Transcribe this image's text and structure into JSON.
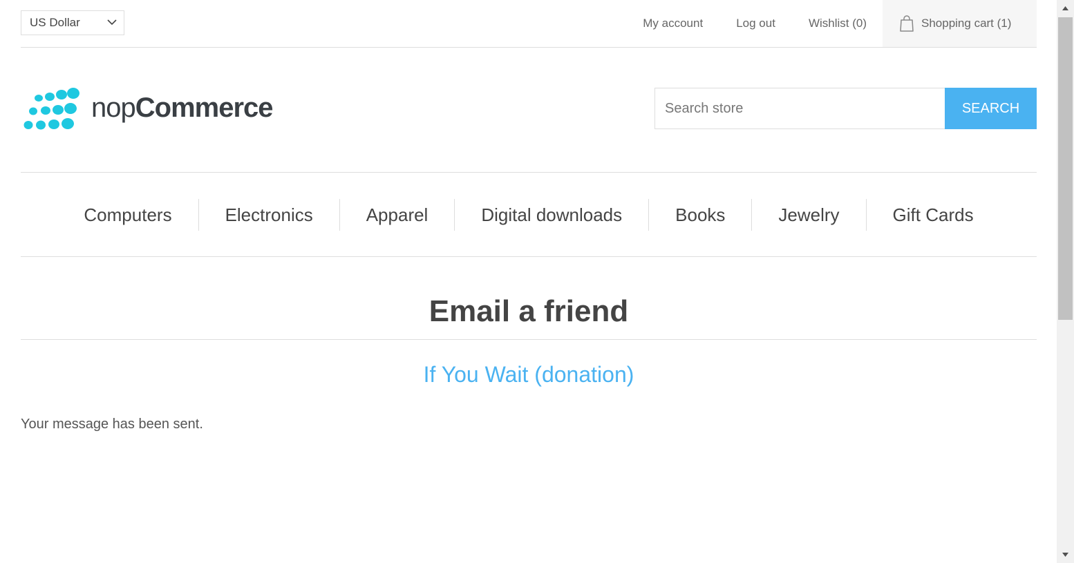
{
  "header": {
    "currency": "US Dollar",
    "links": {
      "my_account": "My account",
      "log_out": "Log out",
      "wishlist": "Wishlist (0)",
      "shopping_cart": "Shopping cart (1)"
    }
  },
  "logo": {
    "text_light": "nop",
    "text_bold": "Commerce"
  },
  "search": {
    "placeholder": "Search store",
    "button": "SEARCH"
  },
  "menu": {
    "items": [
      "Computers",
      "Electronics",
      "Apparel",
      "Digital downloads",
      "Books",
      "Jewelry",
      "Gift Cards"
    ]
  },
  "content": {
    "title": "Email a friend",
    "product_name": "If You Wait (donation)",
    "result": "Your message has been sent."
  },
  "colors": {
    "accent": "#4ab2f1",
    "logo_dots": "#1fc8e0"
  }
}
